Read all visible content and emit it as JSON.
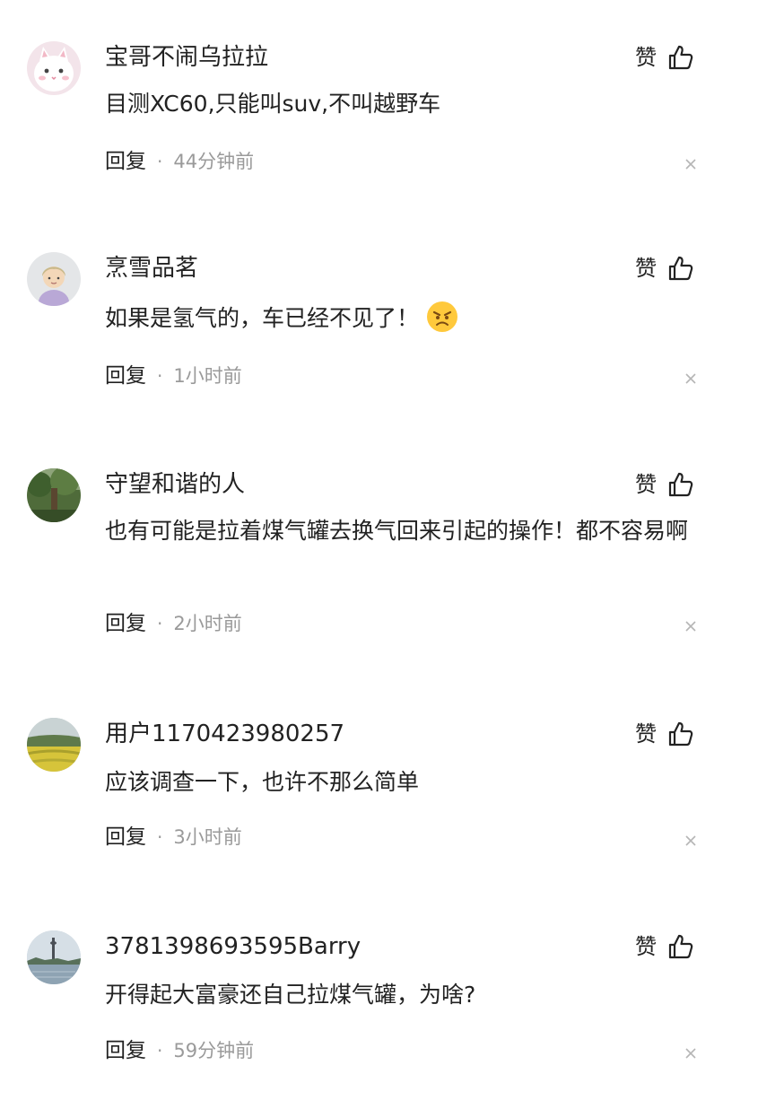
{
  "like_label": "赞",
  "reply_label": "回复",
  "separator": "·",
  "comments": [
    {
      "username": "宝哥不闹乌拉拉",
      "avatar_icon": "white-cat-avatar",
      "text": "目测XC60,只能叫suv,不叫越野车",
      "time": "44分钟前"
    },
    {
      "username": "烹雪品茗",
      "avatar_icon": "cartoon-girl-avatar",
      "text": "如果是氢气的，车已经不见了！",
      "emoji": "angry-face-emoji",
      "time": "1小时前"
    },
    {
      "username": "守望和谐的人",
      "avatar_icon": "tree-photo-avatar",
      "text": "也有可能是拉着煤气罐去换气回来引起的操作！都不容易啊",
      "time": "2小时前"
    },
    {
      "username": "用户1170423980257",
      "avatar_icon": "rapeseed-field-avatar",
      "text": "应该调查一下，也许不那么简单",
      "time": "3小时前"
    },
    {
      "username": "3781398693595Barry",
      "avatar_icon": "tower-lake-avatar",
      "text": "开得起大富豪还自己拉煤气罐，为啥?",
      "time": "59分钟前"
    }
  ],
  "colors": {
    "text": "#222222",
    "meta": "#9a9a9a",
    "emoji_yellow": "#ffc93c"
  }
}
